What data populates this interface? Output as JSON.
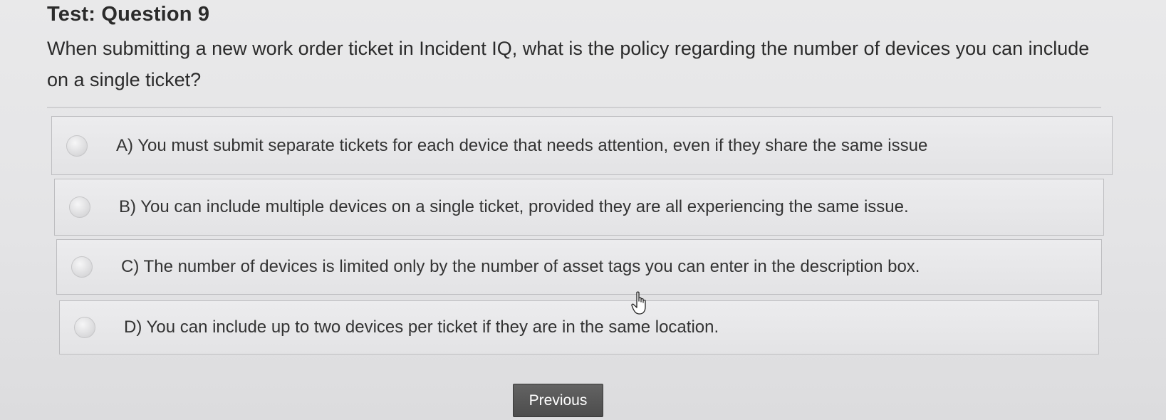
{
  "page": {
    "title": "Test: Question 9"
  },
  "question": {
    "text": "When submitting a new work order ticket in Incident IQ, what is the policy regarding the number of devices you can include on a single ticket?"
  },
  "options": [
    {
      "label": "A)  You must submit separate tickets for each device that needs attention, even if they share the same issue"
    },
    {
      "label": "B)  You can include multiple devices on a single ticket, provided they are all experiencing the same issue."
    },
    {
      "label": "C)  The number of devices is limited only by the number of asset tags you can enter in the description box."
    },
    {
      "label": "D)  You can include up to two devices per ticket if they are in the same location."
    }
  ],
  "navigation": {
    "previous_label": "Previous"
  },
  "colors": {
    "background": "#e6e6e8",
    "option_background": "#e8e8ea",
    "button_background": "#555555",
    "text": "#2b2b2b"
  }
}
